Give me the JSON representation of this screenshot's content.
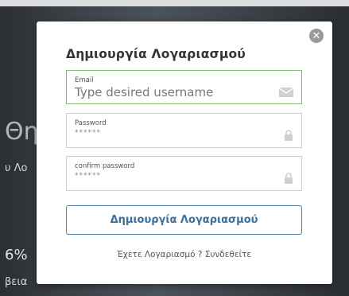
{
  "background": {
    "heading_fragment": "Θη",
    "sub_fragment": "υ Λο",
    "stat_fragment": "6%",
    "small_fragment": "βεια"
  },
  "modal": {
    "title": "Δημιουργία Λογαριασμού",
    "close_icon": "close-icon",
    "fields": {
      "email": {
        "label": "Email",
        "value": "Type desired username",
        "icon": "envelope-icon"
      },
      "password": {
        "label": "Password",
        "placeholder": "******",
        "icon": "lock-icon"
      },
      "confirm_password": {
        "label": "confirm password",
        "placeholder": "******",
        "icon": "lock-icon"
      }
    },
    "submit_label": "Δημιουργία Λογαριασμού",
    "login_prompt": "Έχετε Λογαριασμό ? Συνδεθείτε"
  },
  "colors": {
    "active_border": "#7cc36c",
    "button_border": "#4a7fb0",
    "button_text": "#3c6fa0"
  }
}
